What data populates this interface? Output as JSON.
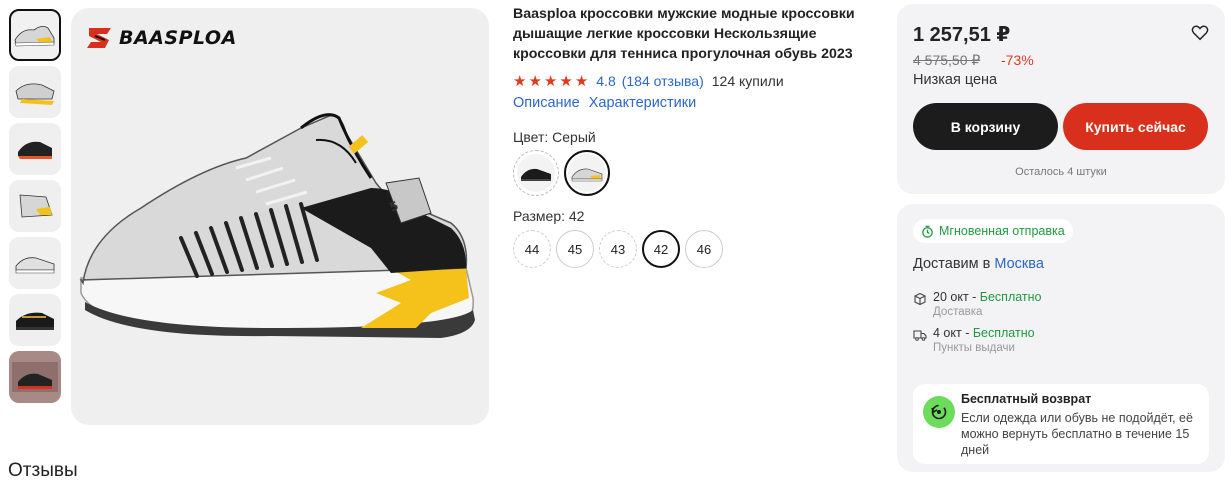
{
  "gallery": {
    "thumbnails": [
      "thumb-1",
      "thumb-2",
      "thumb-3",
      "thumb-4",
      "thumb-5",
      "thumb-6",
      "thumb-7"
    ],
    "brand_logo_text": "BAASPLOA"
  },
  "product": {
    "title": "Baasploa кроссовки мужские модные кроссовки дышащие легкие кроссовки Нескользящие кроссовки для тенниса прогулочная обувь 2023",
    "rating_value": "4.8",
    "reviews_link": "(184 отзыва)",
    "bought": "124 купили",
    "link_description": "Описание",
    "link_specs": "Характеристики",
    "color_label": "Цвет: Серый",
    "size_label": "Размер: 42",
    "sizes": [
      "44",
      "45",
      "43",
      "42",
      "46"
    ]
  },
  "buy": {
    "price": "1 257,51 ₽",
    "old_price": "4 575,50 ₽",
    "discount": "-73%",
    "low_price": "Низкая цена",
    "cart_button": "В корзину",
    "buy_now_button": "Купить сейчас",
    "stock_left": "Осталось 4 штуки"
  },
  "shipping": {
    "instant_badge": "Мгновенная отправка",
    "deliver_prefix": "Доставим в",
    "city": "Москва",
    "option1_date": "20 окт",
    "option1_price": "Бесплатно",
    "option1_type": "Доставка",
    "option2_date": "4 окт",
    "option2_price": "Бесплатно",
    "option2_type": "Пункты выдачи",
    "separator": " - ",
    "return_title": "Бесплатный возврат",
    "return_text": "Если одежда или обувь не подойдёт, её можно вернуть бесплатно в течение 15 дней"
  },
  "reviews_heading": "Отзывы",
  "colors": {
    "accent_red": "#d8301c",
    "link_blue": "#2b67c9",
    "green": "#1e9a3e"
  }
}
